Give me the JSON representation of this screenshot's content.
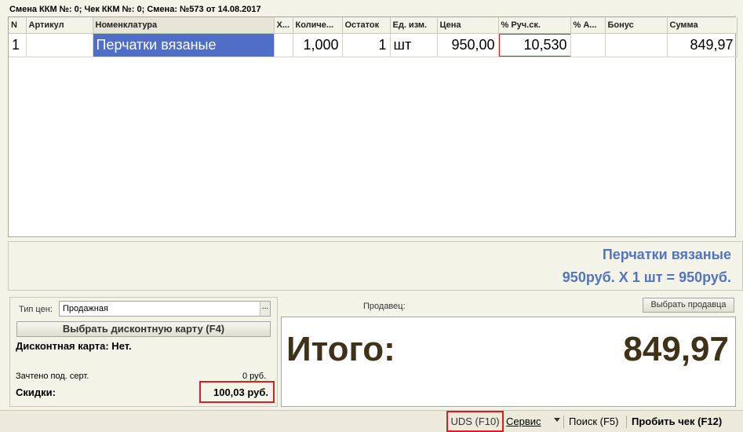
{
  "header": {
    "shift_info": "Смена ККМ №: 0; Чек ККМ №: 0; Смена: №573 от 14.08.2017"
  },
  "table": {
    "columns": [
      "N",
      "Артикул",
      "Номенклатура",
      "Х...",
      "Количе...",
      "Остаток",
      "Ед. изм.",
      "Цена",
      "% Руч.ск.",
      "% А...",
      "Бонус",
      "Сумма"
    ],
    "rows": [
      {
        "n": "1",
        "article": "",
        "nomenclature": "Перчатки вязаные",
        "x": "",
        "quantity": "1,000",
        "stock": "1",
        "unit": "шт",
        "price": "950,00",
        "manual_discount": "10,530",
        "auto_discount": "",
        "bonus": "",
        "sum": "849,97"
      }
    ]
  },
  "info": {
    "item_name": "Перчатки вязаные",
    "calc_line": "950руб. X 1 шт = 950руб."
  },
  "discount_panel": {
    "price_type_label": "Тип цен:",
    "price_type_value": "Продажная",
    "dropdown_glyph": "...",
    "select_card_button": "Выбрать дисконтную карту (F4)",
    "card_line": "Дисконтная карта: Нет.",
    "cert_label": "Зачтено под. серт.",
    "cert_value": "0 руб.",
    "discounts_label": "Скидки:",
    "discounts_value": "100,03 руб."
  },
  "seller": {
    "label": "Продавец:",
    "select_button": "Выбрать продавца"
  },
  "total": {
    "label": "Итого:",
    "value": "849,97"
  },
  "toolbar": {
    "uds": "UDS (F10)",
    "service": "Сервис",
    "search": "Поиск (F5)",
    "print_check": "Пробить чек (F12)"
  },
  "colors": {
    "background": "#f4f3e8",
    "selection": "#4f6ec7",
    "highlight_border": "#d71f28",
    "info_text": "#5574bf",
    "total_text": "#3e3219"
  }
}
